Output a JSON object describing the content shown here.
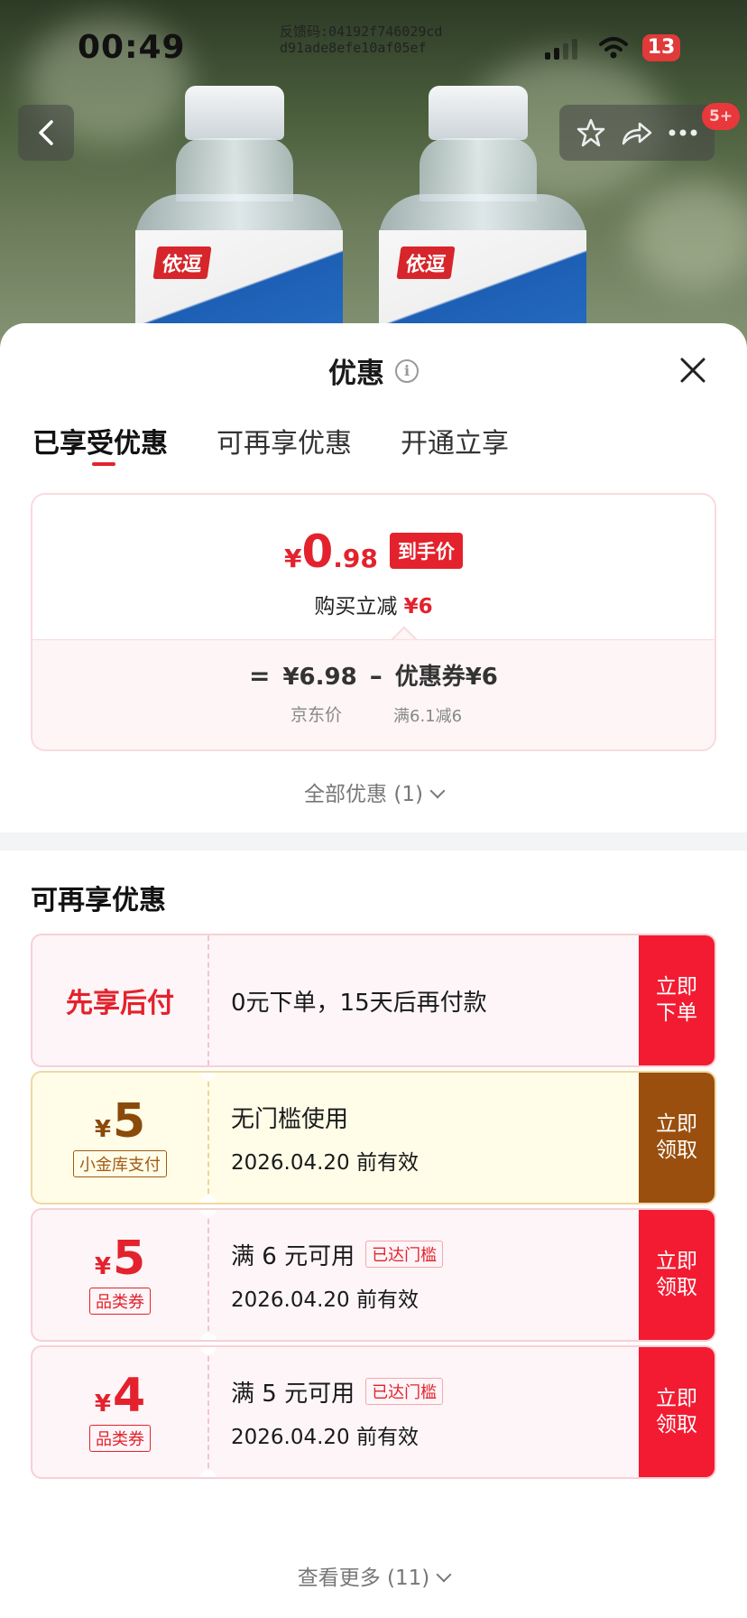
{
  "status_bar": {
    "time": "00:49",
    "feedback_line1": "反馈码:04192f746029cd",
    "feedback_line2": "d91ade8efe10af05ef",
    "battery": "13"
  },
  "product": {
    "brand": "依逗",
    "badge": "5+"
  },
  "sheet": {
    "title": "优惠",
    "tabs": [
      "已享受优惠",
      "可再享优惠",
      "开通立享"
    ]
  },
  "price_card": {
    "yen": "¥",
    "integer": "0",
    "decimal": ".98",
    "tag": "到手价",
    "reduce_label": "购买立减",
    "reduce_value": "¥6",
    "eq": "=",
    "jd_price": "¥6.98",
    "minus": "–",
    "coupon_label": "优惠券¥6",
    "jd_price_label": "京东价",
    "coupon_condition": "满6.1减6"
  },
  "all_discounts": "全部优惠 (1)",
  "more_section": {
    "title": "可再享优惠",
    "coupons": [
      {
        "left_title": "先享后付",
        "line1": "0元下单，15天后再付款",
        "action": "立即下单"
      },
      {
        "yen": "¥",
        "amount": "5",
        "tag": "小金库支付",
        "line1": "无门槛使用",
        "date": "2026.04.20 前有效",
        "action": "立即领取"
      },
      {
        "yen": "¥",
        "amount": "5",
        "tag": "品类券",
        "line1": "满 6 元可用",
        "reached": "已达门槛",
        "date": "2026.04.20 前有效",
        "action": "立即领取"
      },
      {
        "yen": "¥",
        "amount": "4",
        "tag": "品类券",
        "line1": "满 5 元可用",
        "reached": "已达门槛",
        "date": "2026.04.20 前有效",
        "action": "立即领取"
      }
    ]
  },
  "see_more": "查看更多 (11)",
  "colors": {
    "accent_red": "#e3222d",
    "button_red": "#f21b32",
    "gold_button": "#9a4f0e"
  }
}
